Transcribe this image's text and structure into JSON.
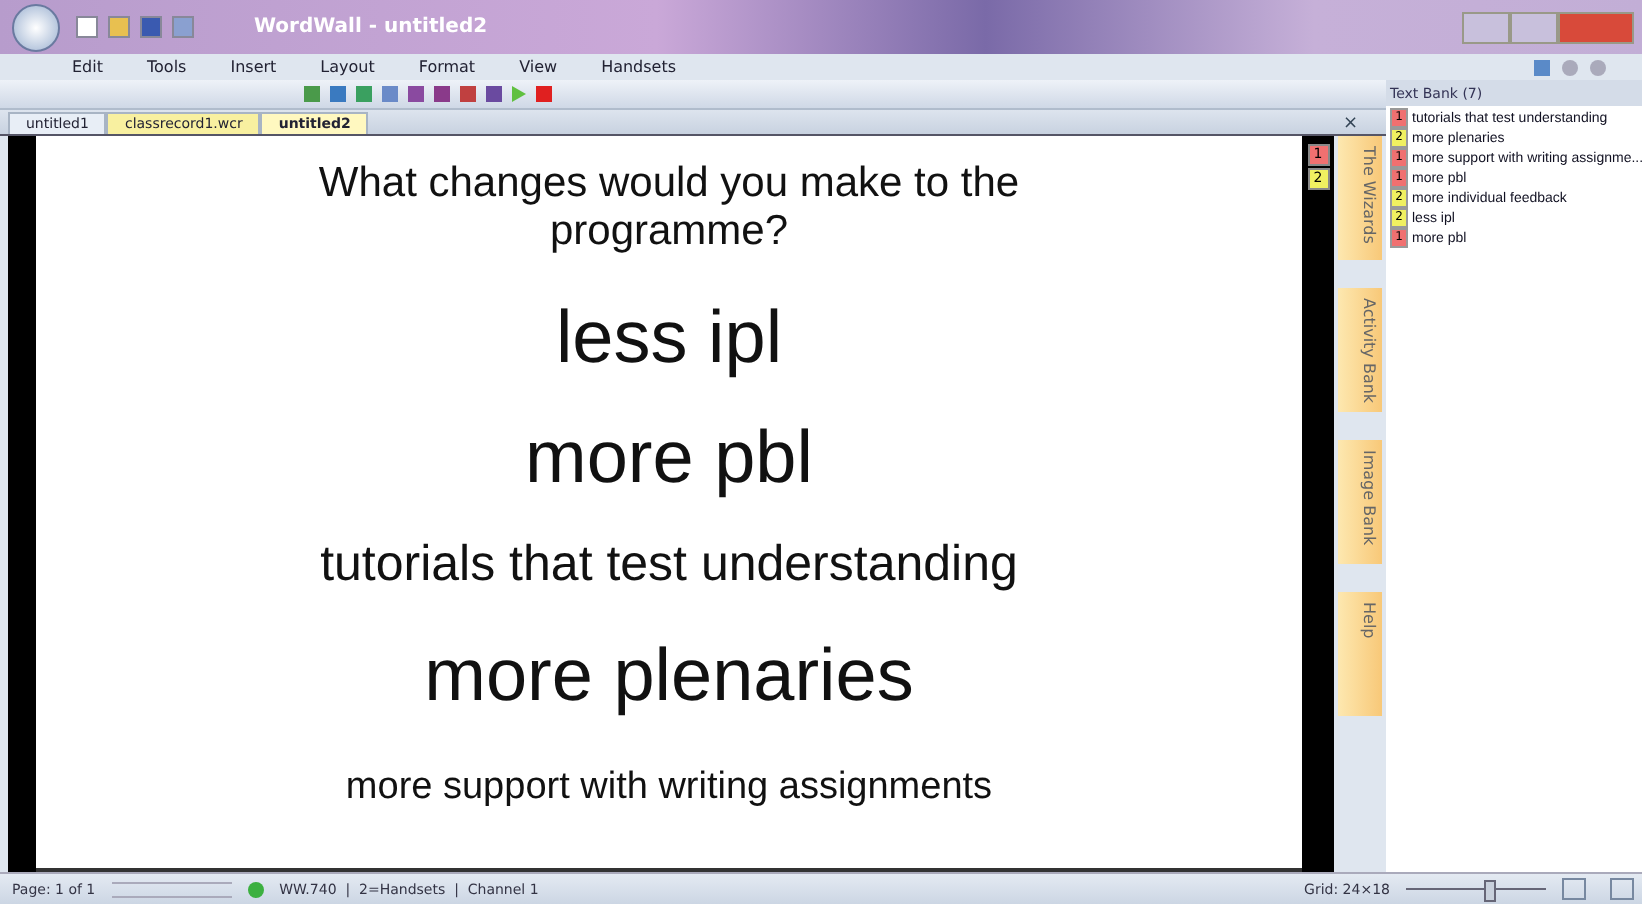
{
  "window": {
    "title": "WordWall - untitled2"
  },
  "menu": [
    "Edit",
    "Tools",
    "Insert",
    "Layout",
    "Format",
    "View",
    "Handsets"
  ],
  "doc_tabs": [
    {
      "label": "untitled1",
      "selected": false,
      "kind": "doc"
    },
    {
      "label": "classrecord1.wcr",
      "selected": false,
      "kind": "record"
    },
    {
      "label": "untitled2",
      "selected": true,
      "kind": "doc"
    }
  ],
  "doc_close": "×",
  "canvas": {
    "lines": [
      {
        "text": "What changes would you make to the programme?",
        "kind": "question"
      },
      {
        "text": "less ipl",
        "kind": "large"
      },
      {
        "text": "more pbl",
        "kind": "large"
      },
      {
        "text": "tutorials that test understanding",
        "kind": "medium"
      },
      {
        "text": "more plenaries",
        "kind": "large"
      },
      {
        "text": "more support with writing assignments",
        "kind": "small"
      }
    ],
    "markers": [
      {
        "text": "1",
        "color": "#f07070"
      },
      {
        "text": "2",
        "color": "#f0f060"
      }
    ]
  },
  "side_tabs": [
    "The Wizards",
    "Activity Bank",
    "Image Bank",
    "Help"
  ],
  "text_bank": {
    "title": "Text Bank (7)",
    "items": [
      {
        "badge": "1",
        "color": "#f07070",
        "text": "tutorials that test understanding"
      },
      {
        "badge": "2",
        "color": "#f0f060",
        "text": "more plenaries"
      },
      {
        "badge": "1",
        "color": "#f07070",
        "text": "more support with writing assignme..."
      },
      {
        "badge": "1",
        "color": "#f07070",
        "text": "more pbl"
      },
      {
        "badge": "2",
        "color": "#f0f060",
        "text": " more individual feedback"
      },
      {
        "badge": "2",
        "color": "#f0f060",
        "text": "less ipl"
      },
      {
        "badge": "1",
        "color": "#f07070",
        "text": "more pbl"
      }
    ]
  },
  "status_bar": {
    "page": "Page: 1 of 1",
    "info": "WW.740  |  2=Handsets  |  Channel 1",
    "grid": "Grid: 24×18",
    "zoom": {
      "level": 0.6
    }
  }
}
